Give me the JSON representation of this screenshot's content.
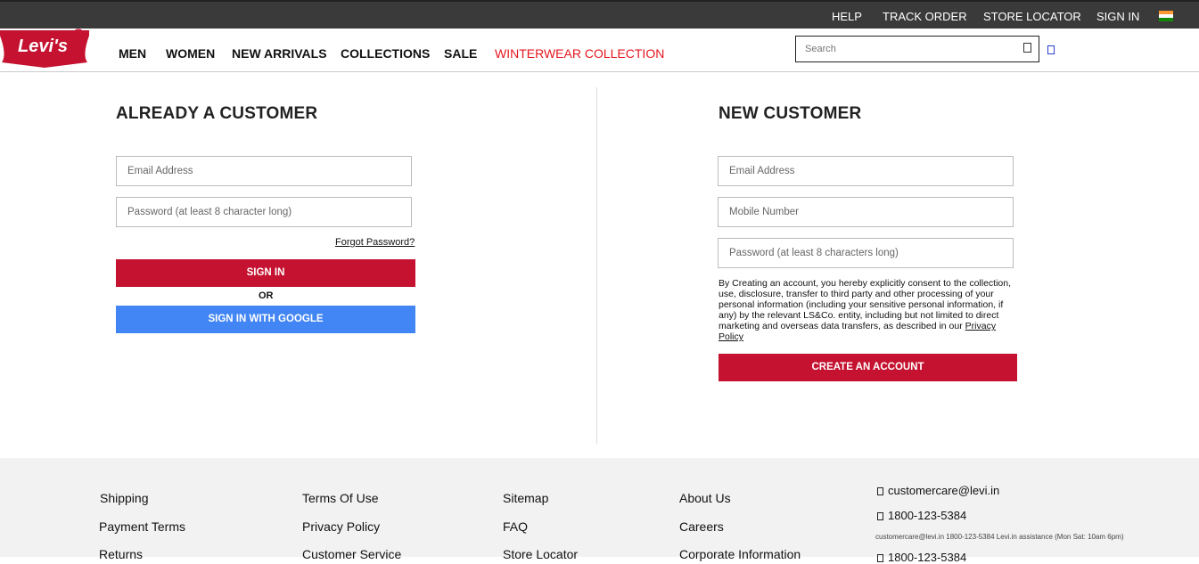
{
  "topbar": {
    "help": "HELP",
    "track_order": "TRACK ORDER",
    "store_locator": "STORE LOCATOR",
    "sign_in": "SIGN IN"
  },
  "header": {
    "logo_text": "Levi's",
    "nav": [
      "MEN",
      "WOMEN",
      "NEW ARRIVALS",
      "COLLECTIONS",
      "SALE",
      "WINTERWEAR COLLECTION"
    ],
    "search_placeholder": "Search"
  },
  "login": {
    "title": "ALREADY A CUSTOMER",
    "email_placeholder": "Email Address",
    "password_placeholder": "Password (at least 8 character long)",
    "forgot": "Forgot Password?",
    "sign_in": "SIGN IN",
    "or": "OR",
    "google": "SIGN IN WITH GOOGLE"
  },
  "register": {
    "title": "NEW CUSTOMER",
    "email_placeholder": "Email Address",
    "mobile_placeholder": "Mobile Number",
    "password_placeholder": "Password (at least 8 characters long)",
    "consent": "By Creating an account, you hereby explicitly consent to the collection, use, disclosure, transfer to third party and other processing of your personal information (including your sensitive personal information, if any) by the relevant LS&Co. entity, including but not limited to direct marketing and overseas data transfers, as described in our ",
    "privacy_link": "Privacy Policy",
    "create": "CREATE AN ACCOUNT"
  },
  "footer": {
    "col1": [
      "Shipping",
      "Payment Terms",
      "Returns"
    ],
    "col2": [
      "Terms Of Use",
      "Privacy Policy",
      "Customer Service"
    ],
    "col3": [
      "Sitemap",
      "FAQ",
      "Store Locator"
    ],
    "col4": [
      "About Us",
      "Careers",
      "Corporate Information"
    ],
    "email": "customercare@levi.in",
    "phone": "1800-123-5384",
    "assist": "customercare@levi.in 1800-123-5384 Levi.in assistance (Mon Sat: 10am 6pm)",
    "phone2": "1800-123-5384"
  },
  "colors": {
    "topbar": "#3a3a3a",
    "brand_red": "#c41230",
    "google_blue": "#4285f4",
    "footer_bg": "#f2f2f2"
  }
}
